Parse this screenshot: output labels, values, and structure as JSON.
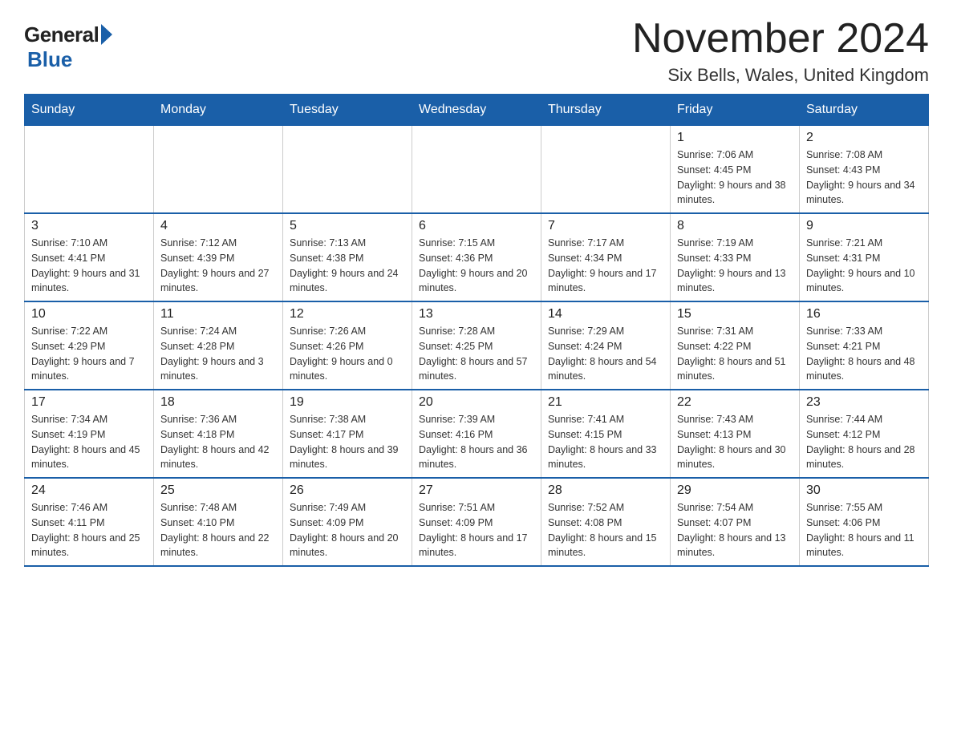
{
  "header": {
    "logo_general": "General",
    "logo_blue": "Blue",
    "title": "November 2024",
    "subtitle": "Six Bells, Wales, United Kingdom"
  },
  "days_of_week": [
    "Sunday",
    "Monday",
    "Tuesday",
    "Wednesday",
    "Thursday",
    "Friday",
    "Saturday"
  ],
  "weeks": [
    [
      {
        "day": "",
        "info": ""
      },
      {
        "day": "",
        "info": ""
      },
      {
        "day": "",
        "info": ""
      },
      {
        "day": "",
        "info": ""
      },
      {
        "day": "",
        "info": ""
      },
      {
        "day": "1",
        "info": "Sunrise: 7:06 AM\nSunset: 4:45 PM\nDaylight: 9 hours and 38 minutes."
      },
      {
        "day": "2",
        "info": "Sunrise: 7:08 AM\nSunset: 4:43 PM\nDaylight: 9 hours and 34 minutes."
      }
    ],
    [
      {
        "day": "3",
        "info": "Sunrise: 7:10 AM\nSunset: 4:41 PM\nDaylight: 9 hours and 31 minutes."
      },
      {
        "day": "4",
        "info": "Sunrise: 7:12 AM\nSunset: 4:39 PM\nDaylight: 9 hours and 27 minutes."
      },
      {
        "day": "5",
        "info": "Sunrise: 7:13 AM\nSunset: 4:38 PM\nDaylight: 9 hours and 24 minutes."
      },
      {
        "day": "6",
        "info": "Sunrise: 7:15 AM\nSunset: 4:36 PM\nDaylight: 9 hours and 20 minutes."
      },
      {
        "day": "7",
        "info": "Sunrise: 7:17 AM\nSunset: 4:34 PM\nDaylight: 9 hours and 17 minutes."
      },
      {
        "day": "8",
        "info": "Sunrise: 7:19 AM\nSunset: 4:33 PM\nDaylight: 9 hours and 13 minutes."
      },
      {
        "day": "9",
        "info": "Sunrise: 7:21 AM\nSunset: 4:31 PM\nDaylight: 9 hours and 10 minutes."
      }
    ],
    [
      {
        "day": "10",
        "info": "Sunrise: 7:22 AM\nSunset: 4:29 PM\nDaylight: 9 hours and 7 minutes."
      },
      {
        "day": "11",
        "info": "Sunrise: 7:24 AM\nSunset: 4:28 PM\nDaylight: 9 hours and 3 minutes."
      },
      {
        "day": "12",
        "info": "Sunrise: 7:26 AM\nSunset: 4:26 PM\nDaylight: 9 hours and 0 minutes."
      },
      {
        "day": "13",
        "info": "Sunrise: 7:28 AM\nSunset: 4:25 PM\nDaylight: 8 hours and 57 minutes."
      },
      {
        "day": "14",
        "info": "Sunrise: 7:29 AM\nSunset: 4:24 PM\nDaylight: 8 hours and 54 minutes."
      },
      {
        "day": "15",
        "info": "Sunrise: 7:31 AM\nSunset: 4:22 PM\nDaylight: 8 hours and 51 minutes."
      },
      {
        "day": "16",
        "info": "Sunrise: 7:33 AM\nSunset: 4:21 PM\nDaylight: 8 hours and 48 minutes."
      }
    ],
    [
      {
        "day": "17",
        "info": "Sunrise: 7:34 AM\nSunset: 4:19 PM\nDaylight: 8 hours and 45 minutes."
      },
      {
        "day": "18",
        "info": "Sunrise: 7:36 AM\nSunset: 4:18 PM\nDaylight: 8 hours and 42 minutes."
      },
      {
        "day": "19",
        "info": "Sunrise: 7:38 AM\nSunset: 4:17 PM\nDaylight: 8 hours and 39 minutes."
      },
      {
        "day": "20",
        "info": "Sunrise: 7:39 AM\nSunset: 4:16 PM\nDaylight: 8 hours and 36 minutes."
      },
      {
        "day": "21",
        "info": "Sunrise: 7:41 AM\nSunset: 4:15 PM\nDaylight: 8 hours and 33 minutes."
      },
      {
        "day": "22",
        "info": "Sunrise: 7:43 AM\nSunset: 4:13 PM\nDaylight: 8 hours and 30 minutes."
      },
      {
        "day": "23",
        "info": "Sunrise: 7:44 AM\nSunset: 4:12 PM\nDaylight: 8 hours and 28 minutes."
      }
    ],
    [
      {
        "day": "24",
        "info": "Sunrise: 7:46 AM\nSunset: 4:11 PM\nDaylight: 8 hours and 25 minutes."
      },
      {
        "day": "25",
        "info": "Sunrise: 7:48 AM\nSunset: 4:10 PM\nDaylight: 8 hours and 22 minutes."
      },
      {
        "day": "26",
        "info": "Sunrise: 7:49 AM\nSunset: 4:09 PM\nDaylight: 8 hours and 20 minutes."
      },
      {
        "day": "27",
        "info": "Sunrise: 7:51 AM\nSunset: 4:09 PM\nDaylight: 8 hours and 17 minutes."
      },
      {
        "day": "28",
        "info": "Sunrise: 7:52 AM\nSunset: 4:08 PM\nDaylight: 8 hours and 15 minutes."
      },
      {
        "day": "29",
        "info": "Sunrise: 7:54 AM\nSunset: 4:07 PM\nDaylight: 8 hours and 13 minutes."
      },
      {
        "day": "30",
        "info": "Sunrise: 7:55 AM\nSunset: 4:06 PM\nDaylight: 8 hours and 11 minutes."
      }
    ]
  ]
}
